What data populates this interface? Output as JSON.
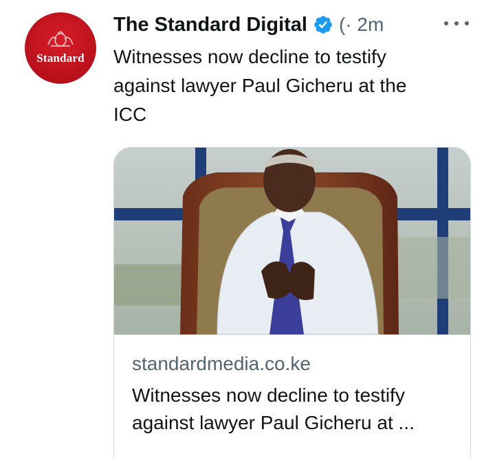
{
  "account": {
    "display_name": "The Standard Digital",
    "avatar_text": "Standard",
    "handle_time": "(· 2m"
  },
  "tweet": {
    "lines": [
      "Witnesses now decline to testify",
      "against lawyer Paul Gicheru at the",
      "ICC"
    ]
  },
  "card": {
    "domain": "standardmedia.co.ke",
    "title_lines": [
      "Witnesses now decline to testify",
      "against lawyer Paul Gicheru at ..."
    ]
  },
  "colors": {
    "verified_blue": "#1d9bf0",
    "brand_red": "#c0141f",
    "secondary_text": "#536471"
  },
  "icons": {
    "verified": "verified-badge-icon",
    "more": "more-options-icon"
  }
}
